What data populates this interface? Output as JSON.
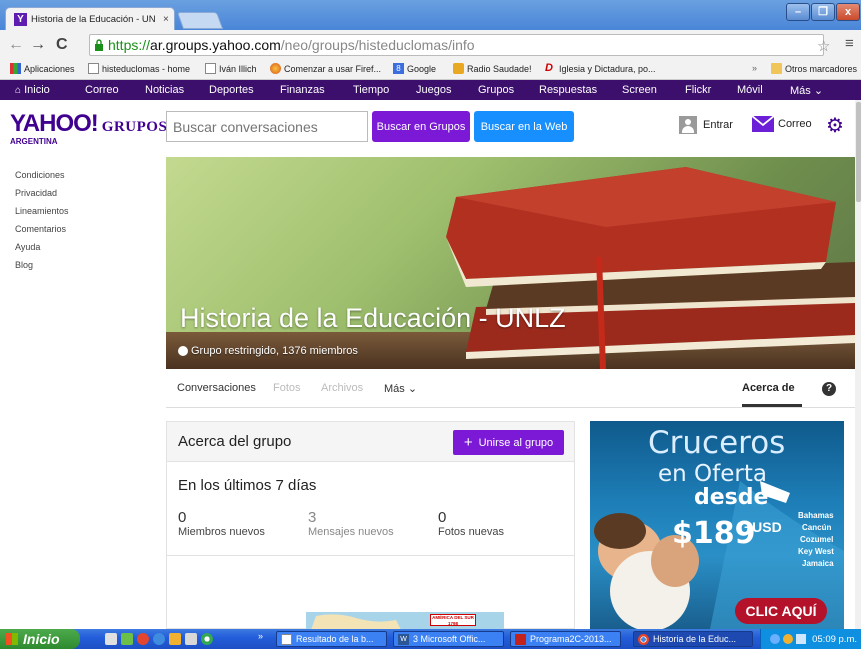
{
  "browser": {
    "tab_title": "Historia de la Educación - UN",
    "tab_close": "×",
    "url_scheme": "https://",
    "url_host": "ar.groups.yahoo.com",
    "url_path": "/neo/groups/histeduclomas/info",
    "bookmarks": [
      {
        "label": "Aplicaciones",
        "icon": "apps-grid-icon"
      },
      {
        "label": "histeduclomas - home",
        "icon": "page-icon"
      },
      {
        "label": "Iván Illich",
        "icon": "page-icon"
      },
      {
        "label": "Comenzar a usar Firef...",
        "icon": "firefox-icon"
      },
      {
        "label": "Google",
        "icon": "google-icon"
      },
      {
        "label": "Radio Saudade!",
        "icon": "radio-icon"
      },
      {
        "label": "Iglesia y Dictadura, po...",
        "icon": "d-logo-icon"
      }
    ],
    "bookmarks_overflow": "»",
    "other_bookmarks": "Otros marcadores",
    "window_buttons": [
      "–",
      "❐",
      "x"
    ]
  },
  "yahoo_nav": {
    "items": [
      "Inicio",
      "Correo",
      "Noticias",
      "Deportes",
      "Finanzas",
      "Tiempo",
      "Juegos",
      "Grupos",
      "Respuestas",
      "Screen",
      "Flickr",
      "Móvil",
      "Más ⌄"
    ]
  },
  "header": {
    "logo_main": "YAHOO!",
    "logo_product": "GRUPOS",
    "logo_country": "ARGENTINA",
    "search_placeholder": "Buscar conversaciones",
    "search_groups_label": "Buscar en Grupos",
    "search_web_label": "Buscar en la Web",
    "signin_label": "Entrar",
    "mail_label": "Correo"
  },
  "sidebar": {
    "links": [
      "Condiciones",
      "Privacidad",
      "Lineamientos",
      "Comentarios",
      "Ayuda",
      "Blog"
    ]
  },
  "group": {
    "title": "Historia de la Educación - UNLZ",
    "subtitle": "Grupo restringido, 1376 miembros",
    "tabs": [
      "Conversaciones",
      "Fotos",
      "Archivos",
      "Más ⌄"
    ],
    "active_tab": "Acerca de",
    "help": "?"
  },
  "about": {
    "title": "Acerca del grupo",
    "join_label": "Unirse al grupo",
    "join_plus": "+",
    "stats_title": "En los últimos 7 días",
    "stats": [
      {
        "value": "0",
        "label": "Miembros nuevos"
      },
      {
        "value": "3",
        "label": "Mensajes nuevos"
      },
      {
        "value": "0",
        "label": "Fotos nuevas"
      }
    ],
    "map_label": "AMÉRICA DEL SUR 1798"
  },
  "ad": {
    "line1": "Cruceros",
    "line2": "en Oferta",
    "line3": "desde",
    "price": "$189",
    "price_suffix": "+USD",
    "destinations": [
      "Bahamas",
      "Cancún",
      "Cozumel",
      "Key West",
      "Jamaica"
    ],
    "cta": "CLIC AQUÍ"
  },
  "taskbar": {
    "start": "Inicio",
    "quick_overflow": "»",
    "tasks": [
      {
        "label": "Resultado de la b...",
        "icon": "acrobat-icon",
        "active": false
      },
      {
        "label": "3 Microsoft Offic...",
        "icon": "word-icon",
        "active": false
      },
      {
        "label": "Programa2C-2013...",
        "icon": "pdf-icon",
        "active": false
      },
      {
        "label": "Historia de la Educ...",
        "icon": "chrome-icon",
        "active": true
      }
    ],
    "clock": "05:09 p.m."
  },
  "colors": {
    "yahoo_purple": "#400090",
    "nav_purple": "#3b0f6b",
    "button_purple": "#7b19d7",
    "button_blue": "#188fff"
  }
}
